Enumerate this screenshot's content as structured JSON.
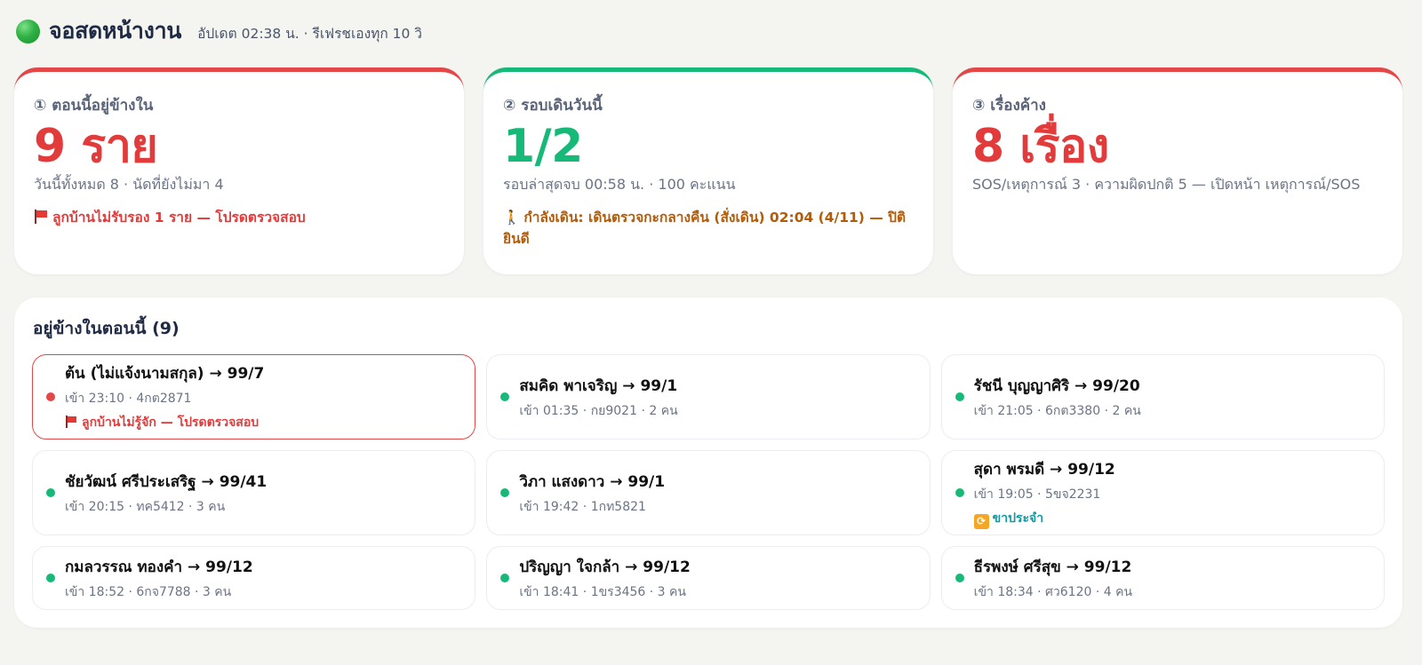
{
  "header": {
    "title": "จอสดหน้างาน",
    "subtitle": "อัปเดต 02:38 น. · รีเฟรชเองทุก 10 วิ"
  },
  "stats": [
    {
      "label": "① ตอนนี้อยู่ข้างใน",
      "value": "9 ราย",
      "sub": "วันนี้ทั้งหมด 8 · นัดที่ยังไม่มา 4",
      "alert": "ลูกบ้านไม่รับรอง 1 ราย — โปรดตรวจสอบ"
    },
    {
      "label": "② รอบเดินวันนี้",
      "value": "1/2",
      "sub": "รอบล่าสุดจบ 00:58 น. · 100 คะแนน",
      "alert": "กำลังเดิน: เดินตรวจกะกลางคืน (สั่งเดิน) 02:04 (4/11) — ปิติ ยินดี"
    },
    {
      "label": "③ เรื่องค้าง",
      "value": "8 เรื่อง",
      "sub": "SOS/เหตุการณ์ 3 · ความผิดปกติ 5 — เปิดหน้า เหตุการณ์/SOS"
    }
  ],
  "visitors": {
    "title": "อยู่ข้างในตอนนี้ (9)",
    "items": [
      {
        "name": "ต้น (ไม่แจ้งนามสกุล) → 99/7",
        "meta": "เข้า 23:10 · 4กต2871",
        "flag": "ลูกบ้านไม่รู้จัก — โปรดตรวจสอบ"
      },
      {
        "name": "สมคิด พาเจริญ → 99/1",
        "meta": "เข้า 01:35 · กย9021 · 2 คน"
      },
      {
        "name": "รัชนี บุญญาศิริ → 99/20",
        "meta": "เข้า 21:05 · 6กต3380 · 2 คน"
      },
      {
        "name": "ชัยวัฒน์ ศรีประเสริฐ → 99/41",
        "meta": "เข้า 20:15 · ทค5412 · 3 คน"
      },
      {
        "name": "วิภา แสงดาว → 99/1",
        "meta": "เข้า 19:42 · 1กท5821"
      },
      {
        "name": "สุดา พรมดี → 99/12",
        "meta": "เข้า 19:05 · 5ขจ2231",
        "tag": "ขาประจำ"
      },
      {
        "name": "กมลวรรณ ทองคำ → 99/12",
        "meta": "เข้า 18:52 · 6กจ7788 · 3 คน"
      },
      {
        "name": "ปริญญา ใจกล้า → 99/12",
        "meta": "เข้า 18:41 · 1ขร3456 · 3 คน"
      },
      {
        "name": "ธีรพงษ์ ศรีสุข → 99/12",
        "meta": "เข้า 18:34 · ศว6120 · 4 คน"
      }
    ]
  },
  "colors": {
    "alert_red": "#e23b3b",
    "ok_green": "#17b978",
    "walk_orange": "#b45b07",
    "tag_teal": "#0f9aa3"
  }
}
